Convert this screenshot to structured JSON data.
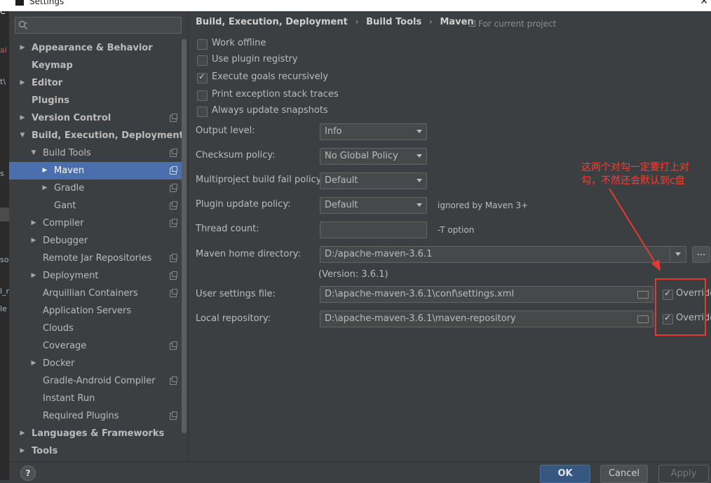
{
  "window": {
    "title": "Settings"
  },
  "sidebar": {
    "items": [
      {
        "label": "Appearance & Behavior",
        "bold": true,
        "arrow": "right",
        "indent": 0,
        "proj": false
      },
      {
        "label": "Keymap",
        "bold": true,
        "arrow": "",
        "indent": 0,
        "proj": false
      },
      {
        "label": "Editor",
        "bold": true,
        "arrow": "right",
        "indent": 0,
        "proj": false
      },
      {
        "label": "Plugins",
        "bold": true,
        "arrow": "",
        "indent": 0,
        "proj": false
      },
      {
        "label": "Version Control",
        "bold": true,
        "arrow": "right",
        "indent": 0,
        "proj": true
      },
      {
        "label": "Build, Execution, Deployment",
        "bold": true,
        "arrow": "down",
        "indent": 0,
        "proj": false
      },
      {
        "label": "Build Tools",
        "bold": false,
        "arrow": "down",
        "indent": 1,
        "proj": true
      },
      {
        "label": "Maven",
        "bold": false,
        "arrow": "right",
        "indent": 2,
        "proj": true,
        "selected": true
      },
      {
        "label": "Gradle",
        "bold": false,
        "arrow": "right",
        "indent": 2,
        "proj": true
      },
      {
        "label": "Gant",
        "bold": false,
        "arrow": "",
        "indent": 2,
        "proj": true
      },
      {
        "label": "Compiler",
        "bold": false,
        "arrow": "right",
        "indent": 1,
        "proj": true
      },
      {
        "label": "Debugger",
        "bold": false,
        "arrow": "right",
        "indent": 1,
        "proj": false
      },
      {
        "label": "Remote Jar Repositories",
        "bold": false,
        "arrow": "",
        "indent": 1,
        "proj": true
      },
      {
        "label": "Deployment",
        "bold": false,
        "arrow": "right",
        "indent": 1,
        "proj": true
      },
      {
        "label": "Arquillian Containers",
        "bold": false,
        "arrow": "",
        "indent": 1,
        "proj": true
      },
      {
        "label": "Application Servers",
        "bold": false,
        "arrow": "",
        "indent": 1,
        "proj": false
      },
      {
        "label": "Clouds",
        "bold": false,
        "arrow": "",
        "indent": 1,
        "proj": false
      },
      {
        "label": "Coverage",
        "bold": false,
        "arrow": "",
        "indent": 1,
        "proj": true
      },
      {
        "label": "Docker",
        "bold": false,
        "arrow": "right",
        "indent": 1,
        "proj": false
      },
      {
        "label": "Gradle-Android Compiler",
        "bold": false,
        "arrow": "",
        "indent": 1,
        "proj": true
      },
      {
        "label": "Instant Run",
        "bold": false,
        "arrow": "",
        "indent": 1,
        "proj": false
      },
      {
        "label": "Required Plugins",
        "bold": false,
        "arrow": "",
        "indent": 1,
        "proj": true
      },
      {
        "label": "Languages & Frameworks",
        "bold": true,
        "arrow": "right",
        "indent": 0,
        "proj": false
      },
      {
        "label": "Tools",
        "bold": true,
        "arrow": "right",
        "indent": 0,
        "proj": false
      }
    ]
  },
  "breadcrumb": {
    "parts": [
      "Build, Execution, Deployment",
      "Build Tools",
      "Maven"
    ],
    "sep": "›",
    "scope": "For current project"
  },
  "options": {
    "work_offline": {
      "label": "Work offline",
      "checked": false
    },
    "use_plugin_registry": {
      "label": "Use plugin registry",
      "checked": false
    },
    "execute_goals": {
      "label": "Execute goals recursively",
      "checked": true
    },
    "print_exception": {
      "label": "Print exception stack traces",
      "checked": false
    },
    "always_update": {
      "label": "Always update snapshots",
      "checked": false
    }
  },
  "fields": {
    "output_level": {
      "label": "Output level:",
      "value": "Info"
    },
    "checksum_policy": {
      "label": "Checksum policy:",
      "value": "No Global Policy"
    },
    "multiproject_fail": {
      "label": "Multiproject build fail policy:",
      "value": "Default"
    },
    "plugin_update": {
      "label": "Plugin update policy:",
      "value": "Default",
      "note": "ignored by Maven 3+"
    },
    "thread_count": {
      "label": "Thread count:",
      "value": "",
      "note": "-T option"
    },
    "maven_home": {
      "label": "Maven home directory:",
      "value": "D:/apache-maven-3.6.1",
      "button": "...",
      "version": "(Version: 3.6.1)"
    },
    "user_settings": {
      "label": "User settings file:",
      "value": "D:\\apache-maven-3.6.1\\conf\\settings.xml",
      "override": "Override",
      "override_checked": true
    },
    "local_repo": {
      "label": "Local repository:",
      "value": "D:\\apache-maven-3.6.1\\maven-repository",
      "override": "Override",
      "override_checked": true
    }
  },
  "annotation": {
    "text": "这两个对勾一定要打上对勾，不然还会默认到c盘",
    "color": "#e53935"
  },
  "footer": {
    "help": "?",
    "ok": "OK",
    "cancel": "Cancel",
    "apply": "Apply"
  },
  "background_fragments": [
    "C",
    "ai",
    "t\\",
    "s",
    "so",
    "l_r",
    "le"
  ]
}
